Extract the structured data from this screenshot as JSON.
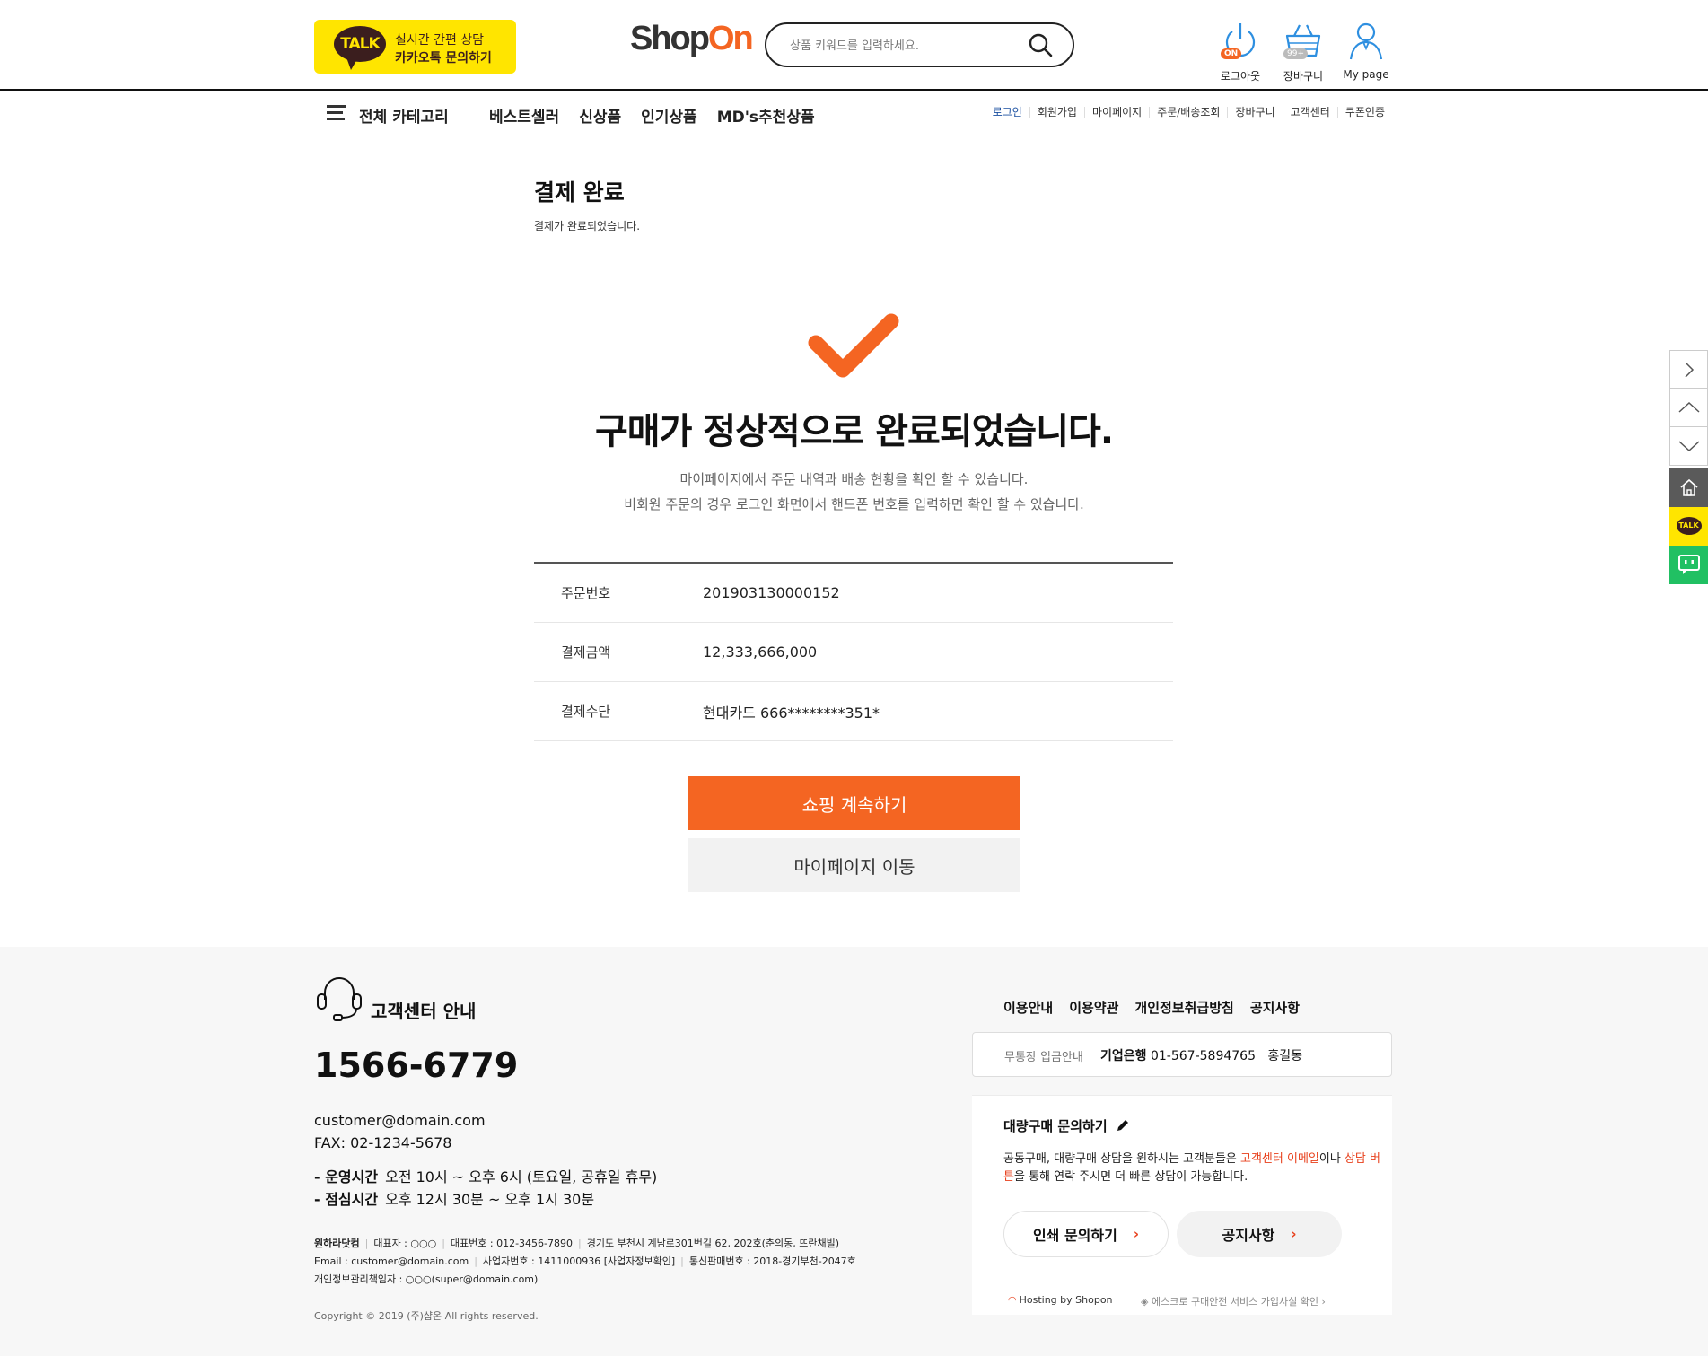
{
  "header": {
    "kakao": {
      "badge": "TALK",
      "line1": "실시간 간편 상담",
      "line2": "카카오톡 문의하기"
    },
    "logo": {
      "part1": "Shop",
      "part2": "On"
    },
    "search": {
      "placeholder": "상품 키워드를 입력하세요."
    },
    "util": [
      {
        "label": "로그아웃",
        "badge": "ON",
        "icon": "power-icon"
      },
      {
        "label": "장바구니",
        "badge": "99+",
        "icon": "basket-icon"
      },
      {
        "label": "My page",
        "icon": "user-icon"
      }
    ]
  },
  "nav": {
    "all_category": "전체 카테고리",
    "main": [
      "베스트셀러",
      "신상품",
      "인기상품",
      "MD's추천상품"
    ],
    "util": [
      "로그인",
      "회원가입",
      "마이페이지",
      "주문/배송조회",
      "장바구니",
      "고객센터",
      "쿠폰인증"
    ]
  },
  "page": {
    "title": "결제 완료",
    "subtitle": "결제가 완료되었습니다.",
    "headline": "구매가 정상적으로 완료되었습니다.",
    "desc1": "마이페이지에서 주문 내역과 배송 현황을 확인 할 수 있습니다.",
    "desc2": "비회원 주문의 경우 로그인 화면에서 핸드폰 번호를 입력하면 확인 할 수 있습니다.",
    "info": [
      {
        "label": "주문번호",
        "value": "201903130000152"
      },
      {
        "label": "결제금액",
        "value": "12,333,666,000"
      },
      {
        "label": "결제수단",
        "value": "현대카드 666********351*"
      }
    ],
    "btn_continue": "쇼핑 계속하기",
    "btn_mypage": "마이페이지 이동",
    "accent": "#f46522"
  },
  "quick": {
    "talk": "TALK"
  },
  "footer": {
    "cs_title": "고객센터 안내",
    "phone": "1566-6779",
    "email": "customer@domain.com",
    "fax": "FAX: 02-1234-5678",
    "hours_label": "- 운영시간",
    "hours": "오전 10시 ~ 오후 6시 (토요일, 공휴일 휴무)",
    "lunch_label": "- 점심시간",
    "lunch": "오후 12시 30분 ~ 오후 1시 30분",
    "company_line1": [
      "원하라닷컴",
      "대표자 : ○○○",
      "대표번호 : 012-3456-7890",
      "경기도 부천시 계남로301번길 62, 202호(춘의동, 뜨란채빌)"
    ],
    "company_line2": [
      "Email : customer@domain.com",
      "사업자번호 : 1411000936 [사업자정보확인]",
      "통신판매번호 : 2018-경기부천-2047호"
    ],
    "company_line3": "개인정보관리책임자 : ○○○(super@domain.com)",
    "copyright": "Copyright © 2019 (주)샵온 All rights reserved.",
    "links": [
      "이용안내",
      "이용약관",
      "개인정보취급방침",
      "공지사항"
    ],
    "bank_label": "무통장 입금안내",
    "bank_name": "기업은행",
    "bank_account": "01-567-5894765",
    "bank_holder": "홍길동",
    "bulk_title": "대량구매 문의하기",
    "bulk_desc_a": "공동구매, 대량구매 상담을 원하시는 고객분들은 ",
    "bulk_desc_cs": "고객센터",
    "bulk_desc_email": "이메일",
    "bulk_desc_b": "이나 ",
    "bulk_desc_btn": "상담 버튼",
    "bulk_desc_c": "을 통해 연락 주시면 더 빠른 상담이 가능합니다.",
    "pill1": "인쇄 문의하기",
    "pill2": "공지사항",
    "hosting": "Hosting by Shopon",
    "escrow": "에스크로 구매안전 서비스 가입사실 확인"
  }
}
